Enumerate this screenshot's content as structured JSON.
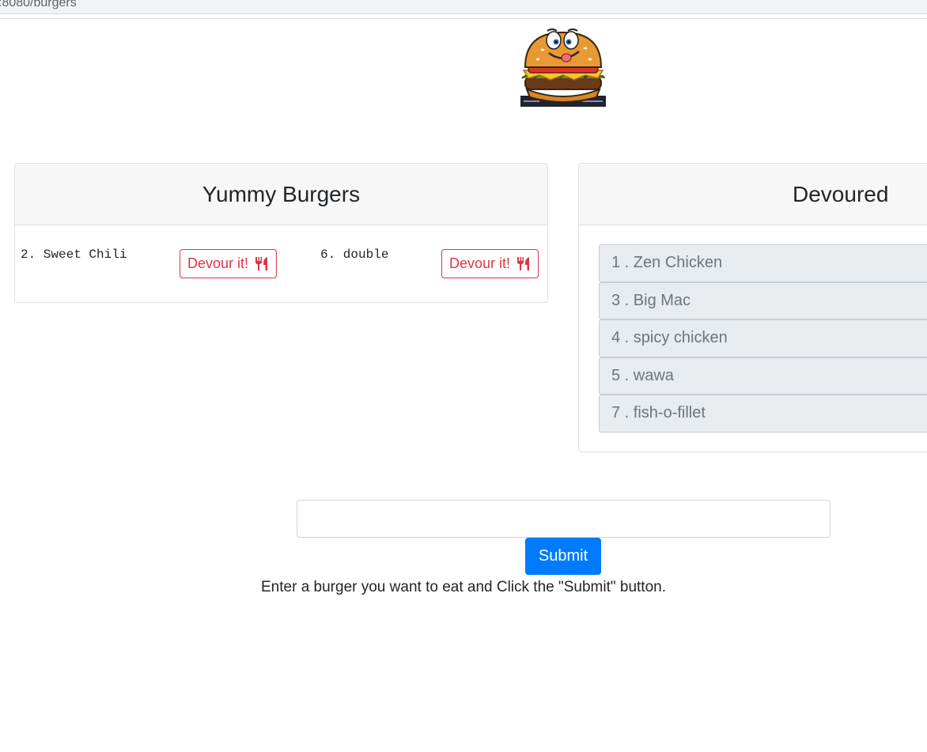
{
  "browser": {
    "url_fragment": ":8080/burgers"
  },
  "logo": {
    "icon": "burger-mascot-icon"
  },
  "yummy": {
    "title": "Yummy Burgers",
    "items": [
      {
        "label": "2. Sweet Chili",
        "button": "Devour it!"
      },
      {
        "label": "6. double",
        "button": "Devour it!"
      }
    ]
  },
  "devoured": {
    "title": "Devoured",
    "items": [
      "1 . Zen Chicken",
      "3 . Big Mac",
      "4 . spicy chicken",
      "5 . wawa",
      "7 . fish-o-fillet"
    ]
  },
  "form": {
    "input_value": "",
    "submit_label": "Submit",
    "instructions": "Enter a burger you want to eat and Click the \"Submit\" button."
  },
  "colors": {
    "danger": "#dc3545",
    "primary": "#007bff",
    "list_bg": "#e9ecef"
  }
}
